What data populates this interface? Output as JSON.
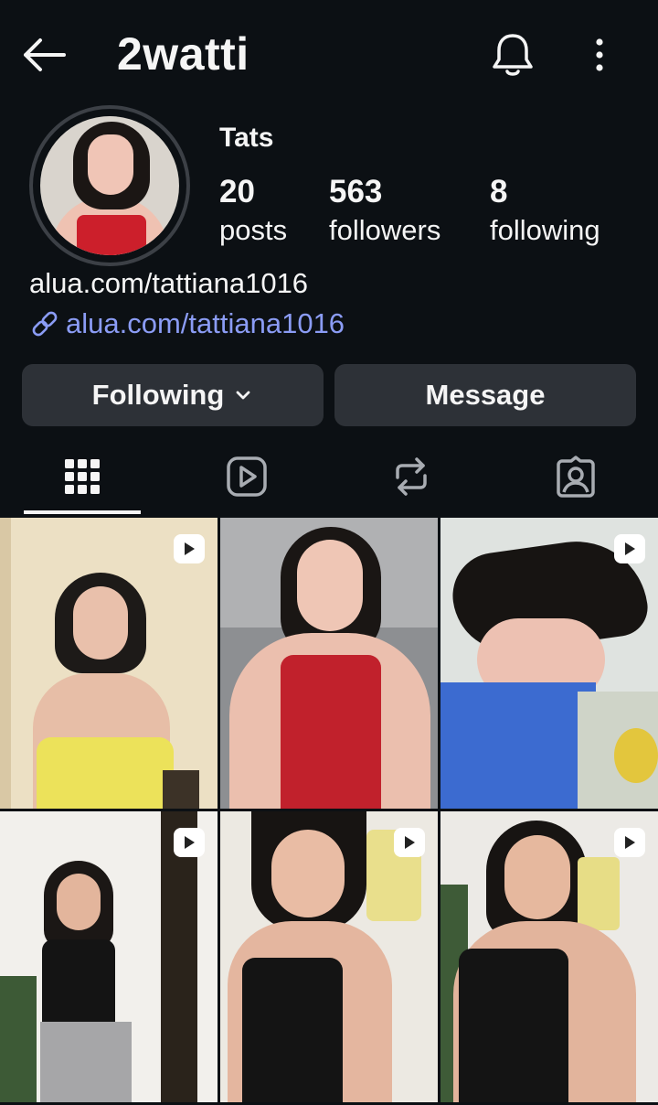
{
  "header": {
    "username": "2watti",
    "back_icon": "arrow-left-icon",
    "notify_icon": "bell-icon",
    "more_icon": "more-vertical-icon"
  },
  "profile": {
    "display_name": "Tats",
    "stats": [
      {
        "count": "20",
        "label": "posts"
      },
      {
        "count": "563",
        "label": "followers"
      },
      {
        "count": "8",
        "label": "following"
      }
    ],
    "bio": "alua.com/tattiana1016",
    "link": "alua.com/tattiana1016",
    "link_color": "#8b9cf5"
  },
  "actions": {
    "following_label": "Following",
    "message_label": "Message"
  },
  "tabs": [
    {
      "icon": "grid-icon",
      "active": true
    },
    {
      "icon": "reels-icon",
      "active": false
    },
    {
      "icon": "reposts-icon",
      "active": false
    },
    {
      "icon": "tagged-icon",
      "active": false
    }
  ],
  "posts": [
    {
      "type": "reel"
    },
    {
      "type": "photo"
    },
    {
      "type": "reel"
    },
    {
      "type": "reel"
    },
    {
      "type": "reel"
    },
    {
      "type": "reel"
    }
  ]
}
